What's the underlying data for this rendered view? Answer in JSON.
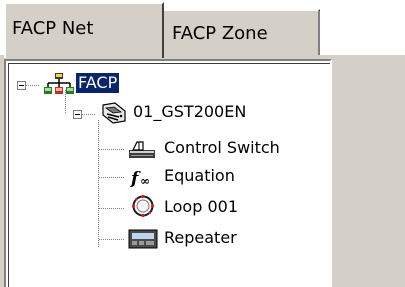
{
  "tabs": {
    "net_label": "FACP Net",
    "zone_label": "FACP Zone"
  },
  "tree": {
    "root": {
      "label": "FACP",
      "icon": "network-icon",
      "selected": true,
      "expanded": true
    },
    "panel": {
      "label": "01_GST200EN",
      "icon": "panel-icon",
      "expanded": true
    },
    "children": [
      {
        "label": "Control Switch",
        "icon": "control-switch-icon"
      },
      {
        "label": "Equation",
        "icon": "function-icon"
      },
      {
        "label": "Loop 001",
        "icon": "loop-icon"
      },
      {
        "label": "Repeater",
        "icon": "repeater-icon"
      }
    ]
  },
  "colors": {
    "selection_bg": "#0a246a",
    "selection_fg": "#ffffff",
    "chrome": "#d4d0c8"
  }
}
